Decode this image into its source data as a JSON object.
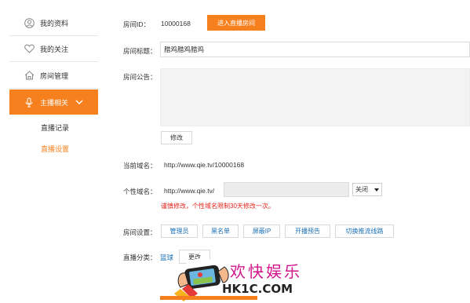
{
  "sidebar": {
    "items": [
      {
        "label": "我的资料",
        "icon": "user-icon"
      },
      {
        "label": "我的关注",
        "icon": "heart-icon"
      },
      {
        "label": "房间管理",
        "icon": "home-icon"
      }
    ],
    "active": {
      "label": "主播相关",
      "icon": "microphone-icon"
    },
    "sub_items": [
      {
        "label": "直播记录"
      },
      {
        "label": "直播设置"
      }
    ]
  },
  "room": {
    "id_label": "房间ID：",
    "id_value": "10000168",
    "enter_button": "进入直播房间",
    "title_label": "房间标题：",
    "title_value": "腊鸡腊鸡腊鸡",
    "notice_label": "房间公告：",
    "modify_button": "修改"
  },
  "domain": {
    "current_label": "当前域名：",
    "current_value": "http://www.qie.tv/10000168",
    "custom_label": "个性域名：",
    "custom_prefix": "http://www.qie.tv/",
    "select_value": "关闭",
    "warning": "谨慎修改，个性域名限制30天修改一次。"
  },
  "settings": {
    "label": "房间设置：",
    "buttons": [
      "管理员",
      "黑名单",
      "屏蔽IP",
      "开播预告",
      "切换推流线路"
    ]
  },
  "category": {
    "label": "直播分类：",
    "value": "篮球",
    "change_button": "更改"
  },
  "watermark": {
    "title": "欢快娱乐",
    "subtitle": "HK1C.COM"
  },
  "colors": {
    "accent": "#f7801e",
    "link": "#1a6fb5",
    "warning": "#e2231a"
  }
}
